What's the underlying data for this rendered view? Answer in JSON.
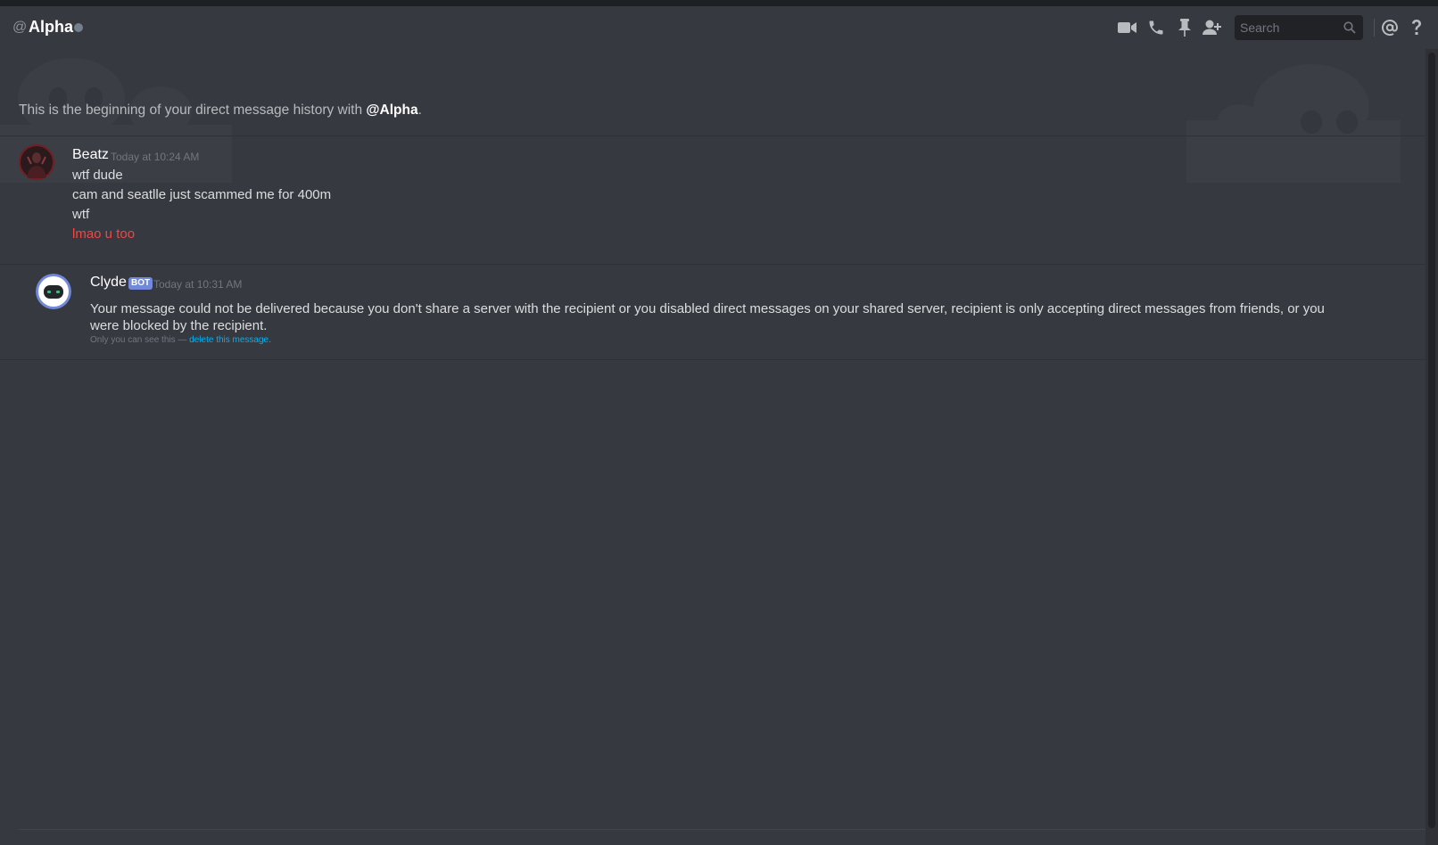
{
  "header": {
    "at_symbol": "@",
    "channel_name": "Alpha",
    "search_placeholder": "Search"
  },
  "intro": {
    "prefix": "This is the beginning of your direct message history with",
    "mention": "@Alpha",
    "suffix": "."
  },
  "messages": [
    {
      "author": "Beatz",
      "timestamp": "Today at 10:24 AM",
      "lines": [
        "wtf dude",
        "cam and seatlle just scammed me for 400m",
        "wtf",
        "lmao u too"
      ]
    },
    {
      "author": "Clyde",
      "tag": "BOT",
      "timestamp": "Today at 10:31 AM",
      "text": "Your message could not be delivered because you don't share a server with the recipient or you disabled direct messages on your shared server, recipient is only accepting direct messages from friends, or you were blocked by the recipient.",
      "ephemeral_note": "Only you can see this —",
      "ephemeral_link": "delete this message."
    }
  ],
  "colors": {
    "background": "#36393f",
    "header_text": "#ffffff",
    "error_text": "#f04747",
    "link": "#00b0f4",
    "bot_tag": "#7289da",
    "status_offline": "#747f8d"
  },
  "icons": [
    "video-call-icon",
    "voice-call-icon",
    "pin-icon",
    "add-friend-icon",
    "search-icon",
    "mention-icon",
    "help-icon"
  ]
}
